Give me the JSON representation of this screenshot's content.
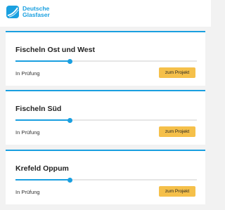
{
  "header": {
    "logo_line1": "Deutsche",
    "logo_line2": "Glasfaser"
  },
  "projects": [
    {
      "title": "Fischeln Ost und West",
      "status": "In Prüfung",
      "button": "zum Projekt",
      "progress": 0.3
    },
    {
      "title": "Fischeln Süd",
      "status": "In Prüfung",
      "button": "zum Projekt",
      "progress": 0.3
    },
    {
      "title": "Krefeld Oppum",
      "status": "In Prüfung",
      "button": "zum Projekt",
      "progress": 0.3
    }
  ],
  "colors": {
    "accent": "#1a9fe0",
    "button": "#f5c04a",
    "background": "#f2f2f2"
  }
}
